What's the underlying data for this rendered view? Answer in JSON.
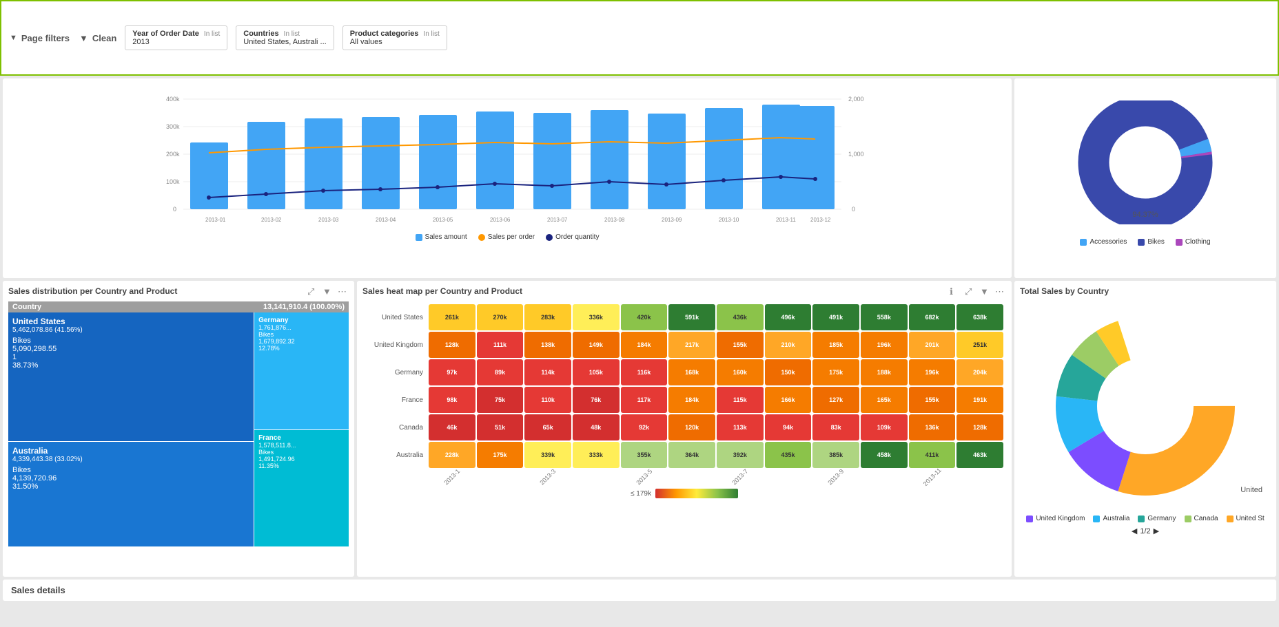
{
  "filterBar": {
    "title": "Page filters",
    "cleanLabel": "Clean",
    "filters": [
      {
        "label": "Year of Order Date",
        "type": "In list",
        "value": "2013"
      },
      {
        "label": "Countries",
        "type": "In list",
        "value": "United States, Australi ..."
      },
      {
        "label": "Product categories",
        "type": "In list",
        "value": "All values"
      }
    ]
  },
  "barChart": {
    "yLeftLabels": [
      "400k",
      "300k",
      "200k",
      "100k",
      "0"
    ],
    "yRightLabels": [
      "2,000",
      "1,000",
      "0"
    ],
    "xLabels": [
      "2013-01",
      "2013-02",
      "2013-03",
      "2013-04",
      "2013-05",
      "2013-06",
      "2013-07",
      "2013-08",
      "2013-09",
      "2013-10",
      "2013-11",
      "2013-12"
    ],
    "legend": [
      {
        "label": "Sales amount",
        "color": "#42a5f5"
      },
      {
        "label": "Sales per order",
        "color": "#ff9800"
      },
      {
        "label": "Order quantity",
        "color": "#1a237e"
      }
    ]
  },
  "donutTop": {
    "label94": "94.37%",
    "legend": [
      {
        "label": "Accessories",
        "color": "#42a5f5"
      },
      {
        "label": "Bikes",
        "color": "#3949ab"
      },
      {
        "label": "Clothing",
        "color": "#ab47bc"
      }
    ]
  },
  "treemap": {
    "title": "Sales distribution per Country and Product",
    "headerLeft": "Country",
    "headerRight": "13,141,910.4 (100.00%)",
    "cells": [
      {
        "country": "United States",
        "amount": "5,462,078.86 (41.56%)",
        "product": "Bikes",
        "value": "5,090,298.55",
        "pct": "38.73%",
        "rank": "1",
        "color": "#1565c0"
      },
      {
        "country": "Australia",
        "amount": "4,339,443.38 (33.02%)",
        "product": "Bikes",
        "value": "4,139,720.96",
        "pct": "31.50%",
        "color": "#1976d2"
      },
      {
        "country": "Germany",
        "amount": "1,761,876...",
        "product": "Bikes",
        "value": "1,679,892.32",
        "pct": "12.78%",
        "color": "#29b6f6"
      },
      {
        "country": "France",
        "amount": "1,578,511.8...",
        "product": "Bikes",
        "value": "1,491,724.96",
        "pct": "11.35%",
        "color": "#00bcd4"
      }
    ]
  },
  "heatmap": {
    "title": "Sales heat map per Country and Product",
    "rows": [
      {
        "label": "United States",
        "values": [
          "261k",
          "270k",
          "283k",
          "336k",
          "420k",
          "591k",
          "436k",
          "496k",
          "491k",
          "558k",
          "682k",
          "638k"
        ]
      },
      {
        "label": "United Kingdom",
        "values": [
          "128k",
          "111k",
          "138k",
          "149k",
          "184k",
          "217k",
          "155k",
          "210k",
          "185k",
          "196k",
          "201k",
          "251k"
        ]
      },
      {
        "label": "Germany",
        "values": [
          "97k",
          "89k",
          "114k",
          "105k",
          "116k",
          "168k",
          "160k",
          "150k",
          "175k",
          "188k",
          "196k",
          "204k"
        ]
      },
      {
        "label": "France",
        "values": [
          "98k",
          "75k",
          "110k",
          "76k",
          "117k",
          "184k",
          "115k",
          "166k",
          "127k",
          "165k",
          "155k",
          "191k"
        ]
      },
      {
        "label": "Canada",
        "values": [
          "46k",
          "51k",
          "65k",
          "48k",
          "92k",
          "120k",
          "113k",
          "94k",
          "83k",
          "109k",
          "136k",
          "128k"
        ]
      },
      {
        "label": "Australia",
        "values": [
          "228k",
          "175k",
          "339k",
          "333k",
          "355k",
          "364k",
          "392k",
          "435k",
          "385k",
          "458k",
          "411k",
          "463k"
        ]
      }
    ],
    "xLabels": [
      "2013-1",
      "",
      "2013-3",
      "",
      "2013-5",
      "",
      "2013-7",
      "",
      "2013-9",
      "",
      "2013-11",
      ""
    ],
    "legendLabel": "≤ 179k"
  },
  "totalSalesPie": {
    "title": "Total Sales by Country",
    "legend": [
      {
        "label": "United Kingdom",
        "color": "#7c4dff"
      },
      {
        "label": "Australia",
        "color": "#29b6f6"
      },
      {
        "label": "Germany",
        "color": "#26a69a"
      },
      {
        "label": "Canada",
        "color": "#9ccc65"
      },
      {
        "label": "United St",
        "color": "#ffa726"
      }
    ],
    "navPage": "1/2",
    "unitedLabel": "United"
  },
  "salesDetails": {
    "title": "Sales details"
  }
}
